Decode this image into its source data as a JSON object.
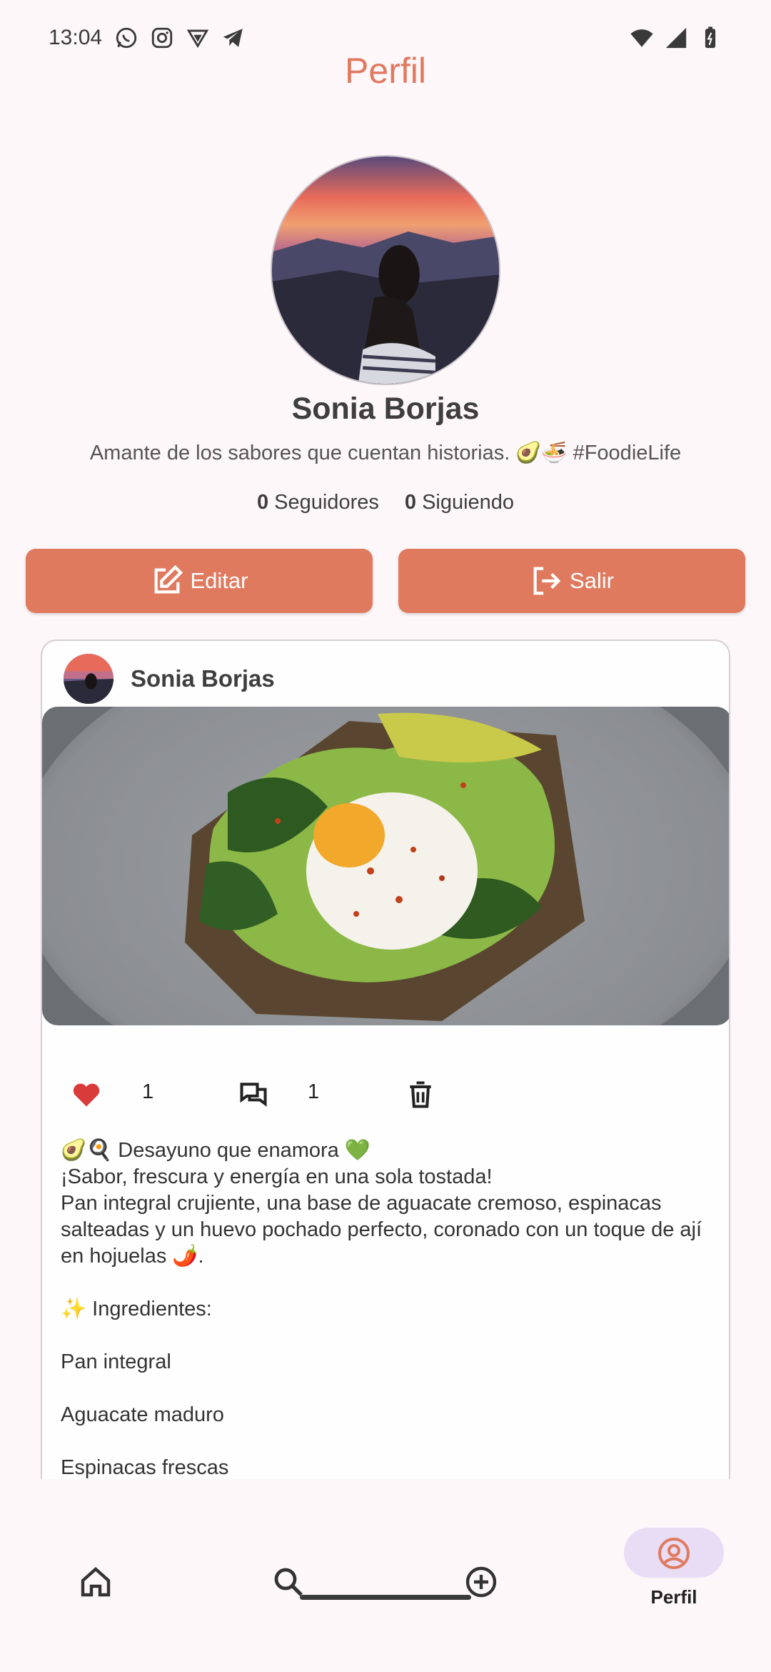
{
  "status_bar": {
    "time": "13:04",
    "app_icons": [
      "whatsapp-icon",
      "instagram-icon",
      "vpn-icon",
      "telegram-icon"
    ],
    "system_icons": [
      "wifi-icon",
      "signal-icon",
      "battery-icon"
    ]
  },
  "header": {
    "title": "Perfil"
  },
  "profile": {
    "name": "Sonia Borjas",
    "bio": "Amante de los sabores que cuentan historias. 🥑🍜 #FoodieLife",
    "followers_count": "0",
    "followers_label": "Seguidores",
    "following_count": "0",
    "following_label": "Siguiendo"
  },
  "actions": {
    "edit_label": "Editar",
    "exit_label": "Salir"
  },
  "post": {
    "author": "Sonia Borjas",
    "likes": "1",
    "comments": "1",
    "body": "🥑🍳 Desayuno que enamora 💚\n¡Sabor, frescura y energía en una sola tostada!\nPan integral crujiente, una base de aguacate cremoso, espinacas salteadas y un huevo pochado perfecto, coronado con un toque de ají en hojuelas 🌶️.\n\n✨ Ingredientes:\n\nPan integral\n\nAguacate maduro\n\nEspinacas frescas"
  },
  "nav": {
    "items": [
      {
        "icon": "home-icon",
        "label": ""
      },
      {
        "icon": "search-icon",
        "label": ""
      },
      {
        "icon": "add-icon",
        "label": ""
      },
      {
        "icon": "profile-icon",
        "label": "Perfil"
      }
    ],
    "active": "Perfil"
  },
  "colors": {
    "accent": "#e07a5f",
    "background": "#fdf7fa",
    "like": "#d93a3a",
    "nav_pill": "#e8ddf4"
  }
}
